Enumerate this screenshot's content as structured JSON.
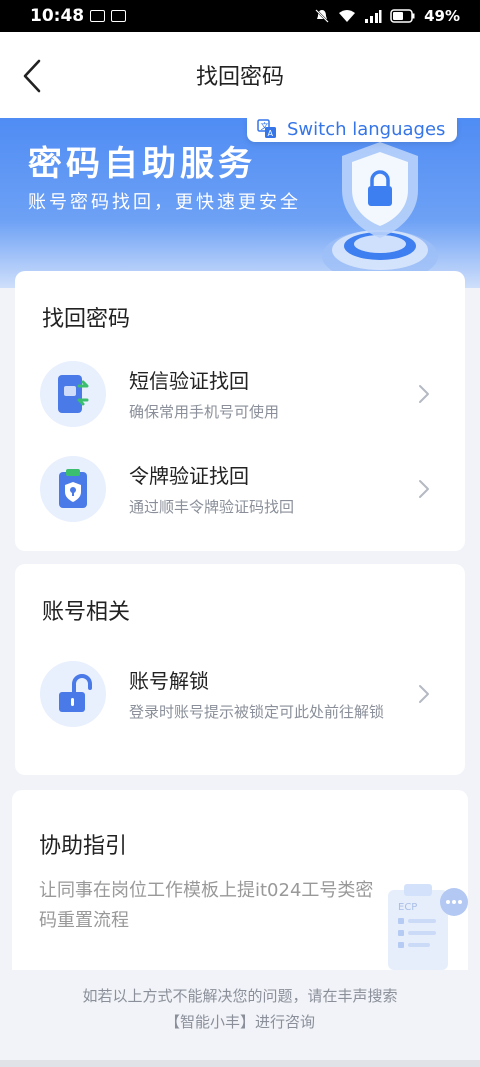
{
  "status_bar": {
    "time": "10:48",
    "battery": "49%"
  },
  "header": {
    "title": "找回密码"
  },
  "banner": {
    "title": "密码自助服务",
    "subtitle": "账号密码找回，更快速更安全",
    "switch_label": "Switch languages"
  },
  "password_section": {
    "title": "找回密码",
    "items": [
      {
        "title": "短信验证找回",
        "desc": "确保常用手机号可使用"
      },
      {
        "title": "令牌验证找回",
        "desc": "通过顺丰令牌验证码找回"
      }
    ]
  },
  "account_section": {
    "title": "账号相关",
    "items": [
      {
        "title": "账号解锁",
        "desc": "登录时账号提示被锁定可此处前往解锁"
      }
    ]
  },
  "guide_section": {
    "title": "协助指引",
    "desc": "让同事在岗位工作模板上提it024工号类密码重置流程",
    "doc_label": "ECP"
  },
  "footer": {
    "line1": "如若以上方式不能解决您的问题，请在丰声搜索",
    "line2": "【智能小丰】进行咨询"
  },
  "colors": {
    "accent": "#3575e8",
    "banner": "#4f8cf4",
    "background": "#f1f3f8"
  }
}
